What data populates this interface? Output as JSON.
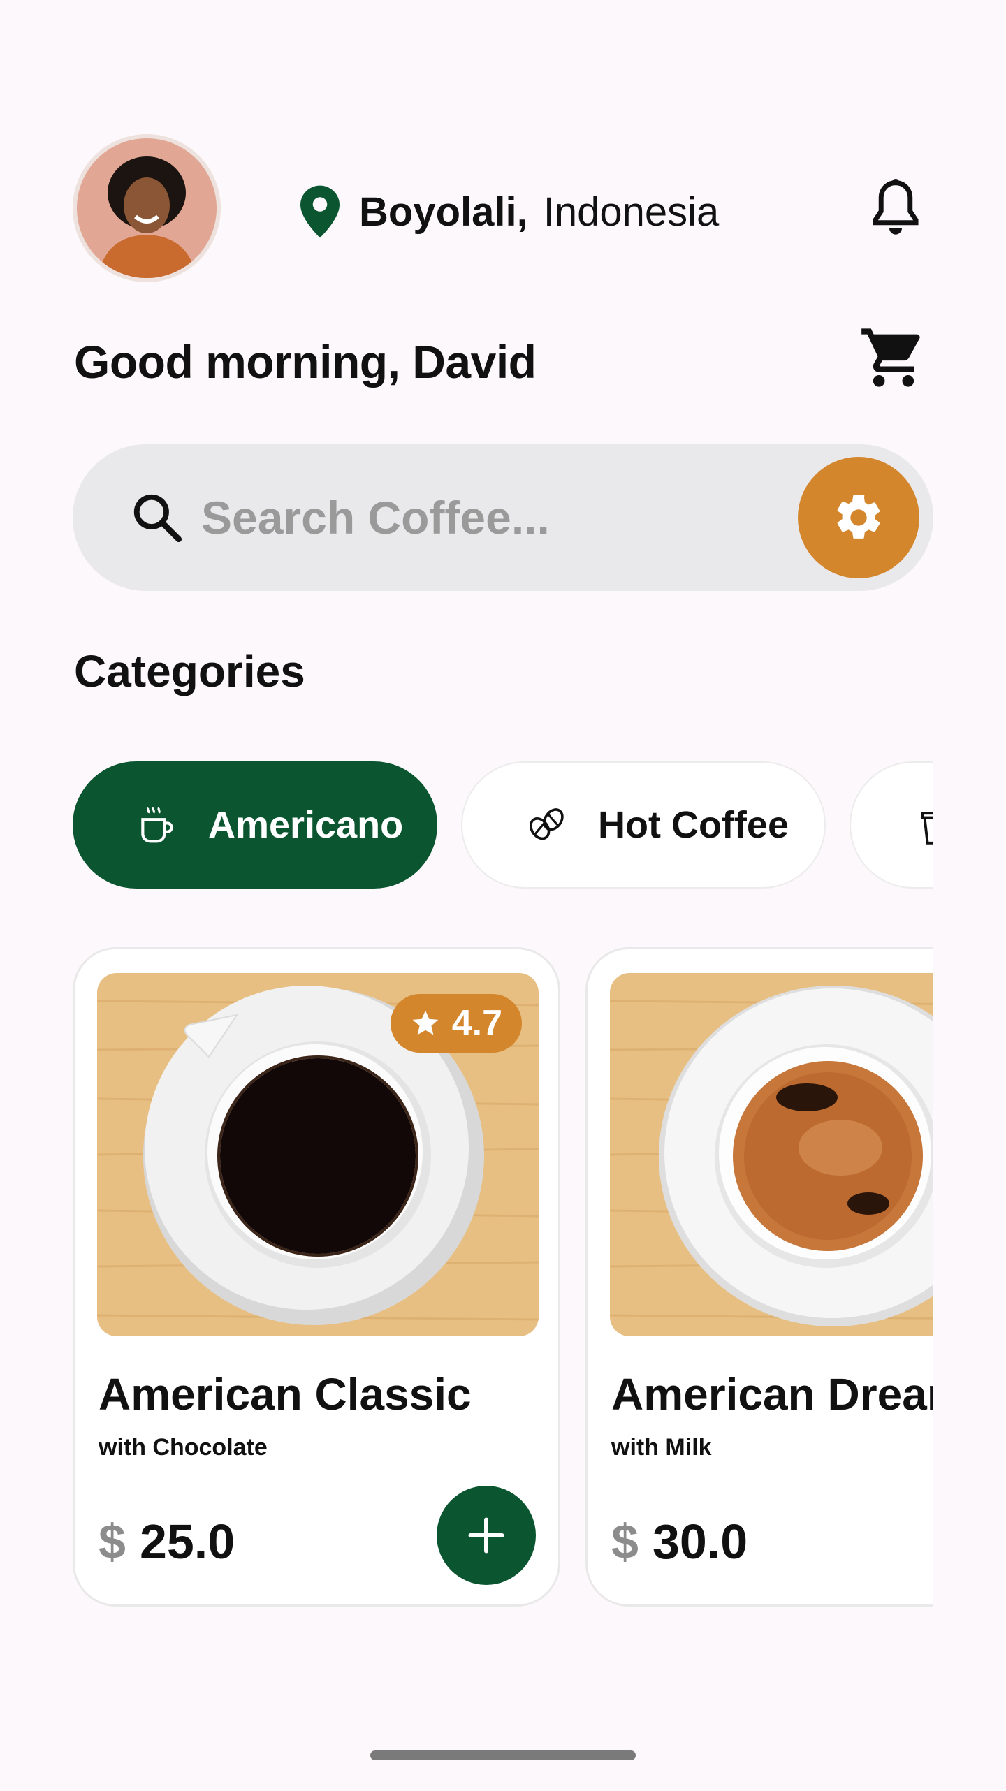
{
  "header": {
    "city": "Boyolali,",
    "country": "Indonesia",
    "greeting": "Good morning, David"
  },
  "search": {
    "placeholder": "Search Coffee..."
  },
  "categories": {
    "title": "Categories",
    "items": [
      {
        "label": "Americano",
        "icon": "coffee-cup-icon",
        "active": true
      },
      {
        "label": "Hot Coffee",
        "icon": "coffee-beans-icon",
        "active": false
      },
      {
        "label": "",
        "icon": "iced-coffee-icon",
        "active": false
      }
    ]
  },
  "products": [
    {
      "name": "American Classic",
      "subtitle": "with Chocolate",
      "currency": "$",
      "price": "25.0",
      "rating": "4.7"
    },
    {
      "name": "American Dream",
      "subtitle": "with Milk",
      "currency": "$",
      "price": "30.0",
      "rating": ""
    }
  ],
  "colors": {
    "primary_green": "#0b5631",
    "accent_orange": "#d4862c",
    "background": "#fdf8fb"
  }
}
